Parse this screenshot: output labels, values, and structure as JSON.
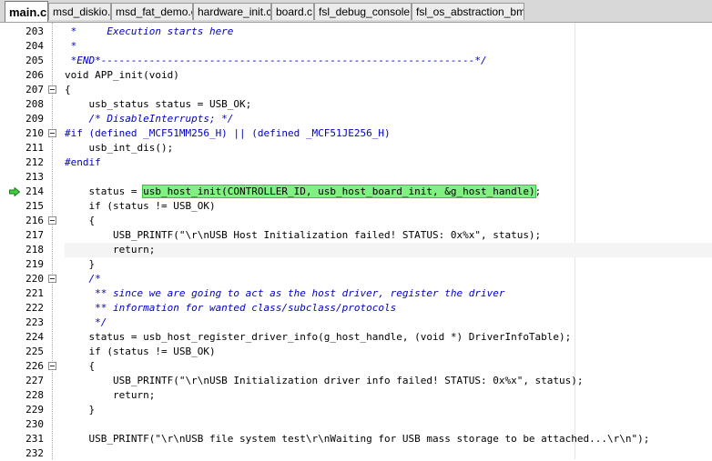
{
  "tabs": [
    {
      "label": "main.c",
      "active": true
    },
    {
      "label": "msd_diskio.c",
      "active": false
    },
    {
      "label": "msd_fat_demo.c",
      "active": false
    },
    {
      "label": "hardware_init.c",
      "active": false
    },
    {
      "label": "board.c",
      "active": false
    },
    {
      "label": "fsl_debug_console.c",
      "active": false
    },
    {
      "label": "fsl_os_abstraction_bm.c",
      "active": false
    }
  ],
  "colors": {
    "comment": "#0000c0",
    "highlight": "#80f080",
    "current_line": "#f4f4f4"
  },
  "editor": {
    "execution_line": 214,
    "current_line": 218,
    "lines": [
      {
        "n": 203,
        "t": " *     Execution starts here",
        "k": "cm"
      },
      {
        "n": 204,
        "t": " *",
        "k": "cm"
      },
      {
        "n": 205,
        "t": " *END*--------------------------------------------------------------*/",
        "k": "cm"
      },
      {
        "n": 206,
        "t": "void APP_init(void)"
      },
      {
        "n": 207,
        "t": "{",
        "fold": true
      },
      {
        "n": 208,
        "t": "    usb_status status = USB_OK;"
      },
      {
        "n": 209,
        "t": "    /* DisableInterrupts; */",
        "k": "cm"
      },
      {
        "n": 210,
        "t": "#if (defined _MCF51MM256_H) || (defined _MCF51JE256_H)",
        "k": "pp",
        "fold": true
      },
      {
        "n": 211,
        "t": "    usb_int_dis();"
      },
      {
        "n": 212,
        "t": "#endif",
        "k": "pp"
      },
      {
        "n": 213,
        "t": ""
      },
      {
        "n": 214,
        "pre": "    status = ",
        "hl": "usb_host_init(CONTROLLER_ID, usb_host_board_init, &g_host_handle)",
        "post": ";"
      },
      {
        "n": 215,
        "t": "    if (status != USB_OK)"
      },
      {
        "n": 216,
        "t": "    {",
        "fold": true
      },
      {
        "n": 217,
        "t": "        USB_PRINTF(\"\\r\\nUSB Host Initialization failed! STATUS: 0x%x\", status);"
      },
      {
        "n": 218,
        "t": "        return;"
      },
      {
        "n": 219,
        "t": "    }"
      },
      {
        "n": 220,
        "t": "    /*",
        "k": "cm",
        "fold": true
      },
      {
        "n": 221,
        "t": "     ** since we are going to act as the host driver, register the driver",
        "k": "cm"
      },
      {
        "n": 222,
        "t": "     ** information for wanted class/subclass/protocols",
        "k": "cm"
      },
      {
        "n": 223,
        "t": "     */",
        "k": "cm"
      },
      {
        "n": 224,
        "t": "    status = usb_host_register_driver_info(g_host_handle, (void *) DriverInfoTable);"
      },
      {
        "n": 225,
        "t": "    if (status != USB_OK)"
      },
      {
        "n": 226,
        "t": "    {",
        "fold": true
      },
      {
        "n": 227,
        "t": "        USB_PRINTF(\"\\r\\nUSB Initialization driver info failed! STATUS: 0x%x\", status);"
      },
      {
        "n": 228,
        "t": "        return;"
      },
      {
        "n": 229,
        "t": "    }"
      },
      {
        "n": 230,
        "t": ""
      },
      {
        "n": 231,
        "t": "    USB_PRINTF(\"\\r\\nUSB file system test\\r\\nWaiting for USB mass storage to be attached...\\r\\n\");"
      },
      {
        "n": 232,
        "t": ""
      }
    ]
  }
}
